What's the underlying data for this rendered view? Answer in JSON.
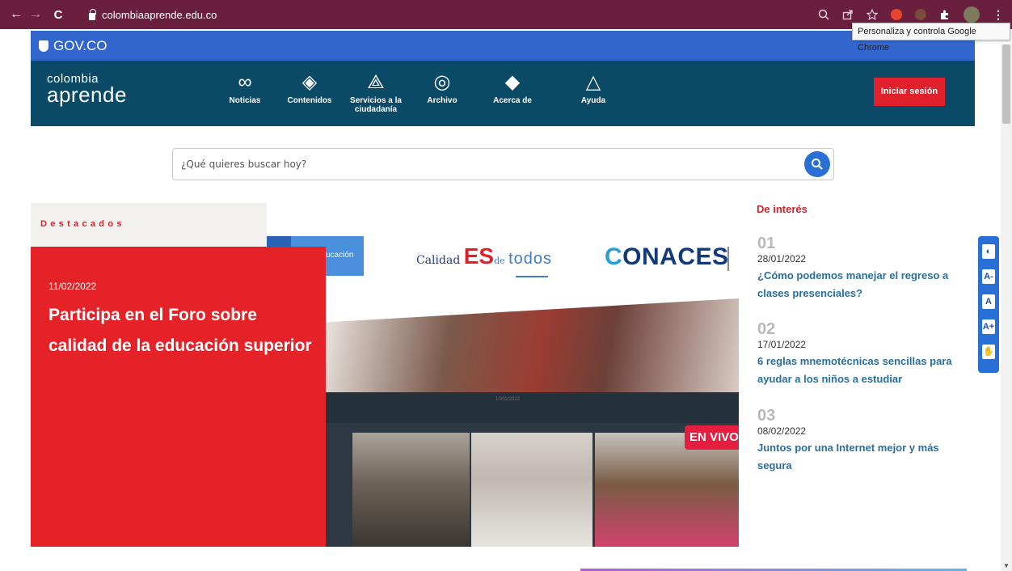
{
  "browser": {
    "url": "colombiaaprende.edu.co",
    "tooltip": "Personaliza y controla Google Chrome",
    "back_icon": "←",
    "forward_icon": "→",
    "reload_icon": "C"
  },
  "gov": {
    "label": "GOV.CO"
  },
  "header": {
    "logo_top": "colombia",
    "logo_bottom": "aprende",
    "nav": [
      {
        "label": "Noticias",
        "icon": "∞"
      },
      {
        "label": "Contenidos",
        "icon": "◈"
      },
      {
        "label": "Servicios a la ciudadanía",
        "icon": "⟁"
      },
      {
        "label": "Archivo",
        "icon": "◎"
      },
      {
        "label": "Acerca de",
        "icon": "◆"
      },
      {
        "label": "Ayuda",
        "icon": "△"
      }
    ],
    "login": "Iniciar sesión"
  },
  "search": {
    "placeholder": "¿Qué quieres buscar hoy?"
  },
  "destacados": {
    "title": "Destacados",
    "date": "11/02/2022",
    "headline": "Participa en el Foro sobre calidad de la educación superior"
  },
  "hero": {
    "blue_text": "ucación",
    "calidad": {
      "a": "Calidad",
      "b": "ES",
      "c": "de",
      "d": "todos"
    },
    "conaces": "ONACES",
    "screen_date": "10/02/2022",
    "live": "EN VIVO"
  },
  "interes": {
    "title": "De interés",
    "items": [
      {
        "num": "01",
        "date": "28/01/2022",
        "text": "¿Cómo podemos manejar el regreso a clases presenciales?"
      },
      {
        "num": "02",
        "date": "17/01/2022",
        "text": "6 reglas mnemotécnicas sencillas para ayudar a los niños a estudiar"
      },
      {
        "num": "03",
        "date": "08/02/2022",
        "text": "Juntos por una Internet mejor y más segura"
      }
    ]
  },
  "accessibility": {
    "buttons": [
      "◐",
      "A-",
      "A",
      "A+",
      "✋"
    ]
  },
  "colors": {
    "chrome": "#6b1f3e",
    "gov": "#3366cc",
    "header": "#0b4a66",
    "accent_red": "#e42227",
    "link": "#2a6f9b"
  }
}
